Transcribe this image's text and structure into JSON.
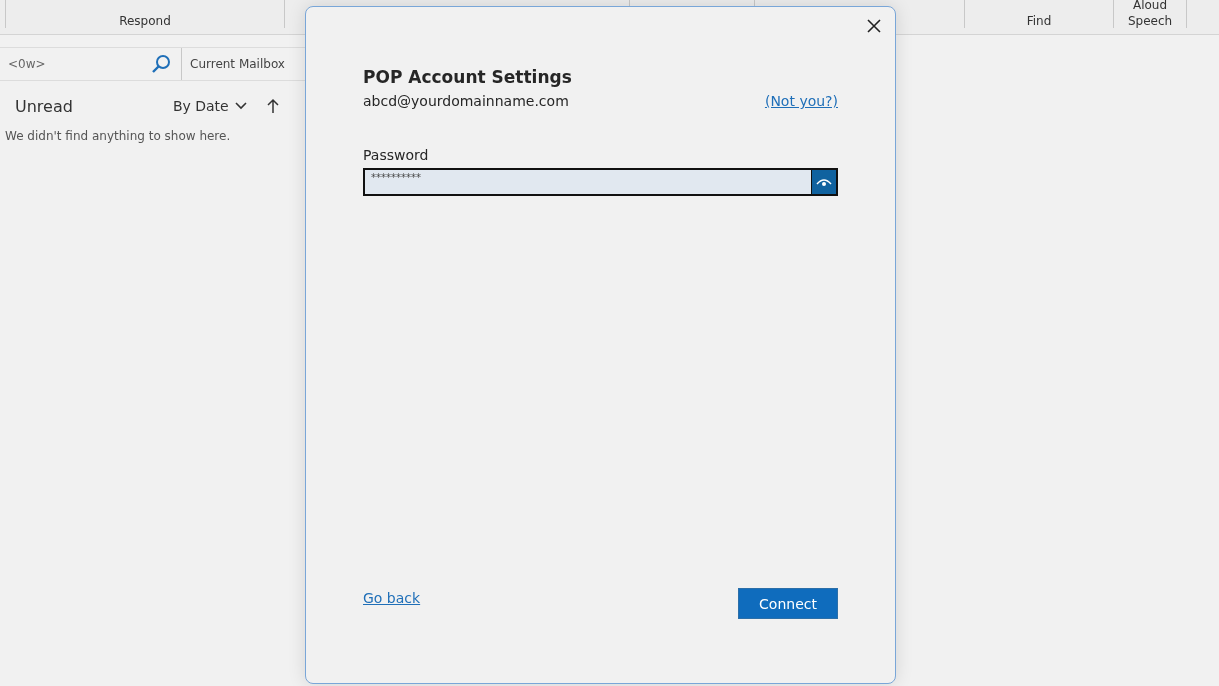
{
  "ribbon": {
    "groups": [
      {
        "label": "Respond"
      },
      {
        "label": "Find"
      },
      {
        "label": "Speech",
        "top_label": "Aloud"
      }
    ]
  },
  "mail_list": {
    "search": {
      "value": "<0w>"
    },
    "scope": "Current Mailbox",
    "filter": "Unread",
    "sort": "By Date",
    "empty_message": "We didn't find anything to show here."
  },
  "dialog": {
    "title": "POP Account Settings",
    "email": "abcd@yourdomainname.com",
    "not_you": "(Not you?)",
    "password": {
      "label": "Password",
      "value": "**********"
    },
    "go_back": "Go back",
    "connect": "Connect"
  }
}
